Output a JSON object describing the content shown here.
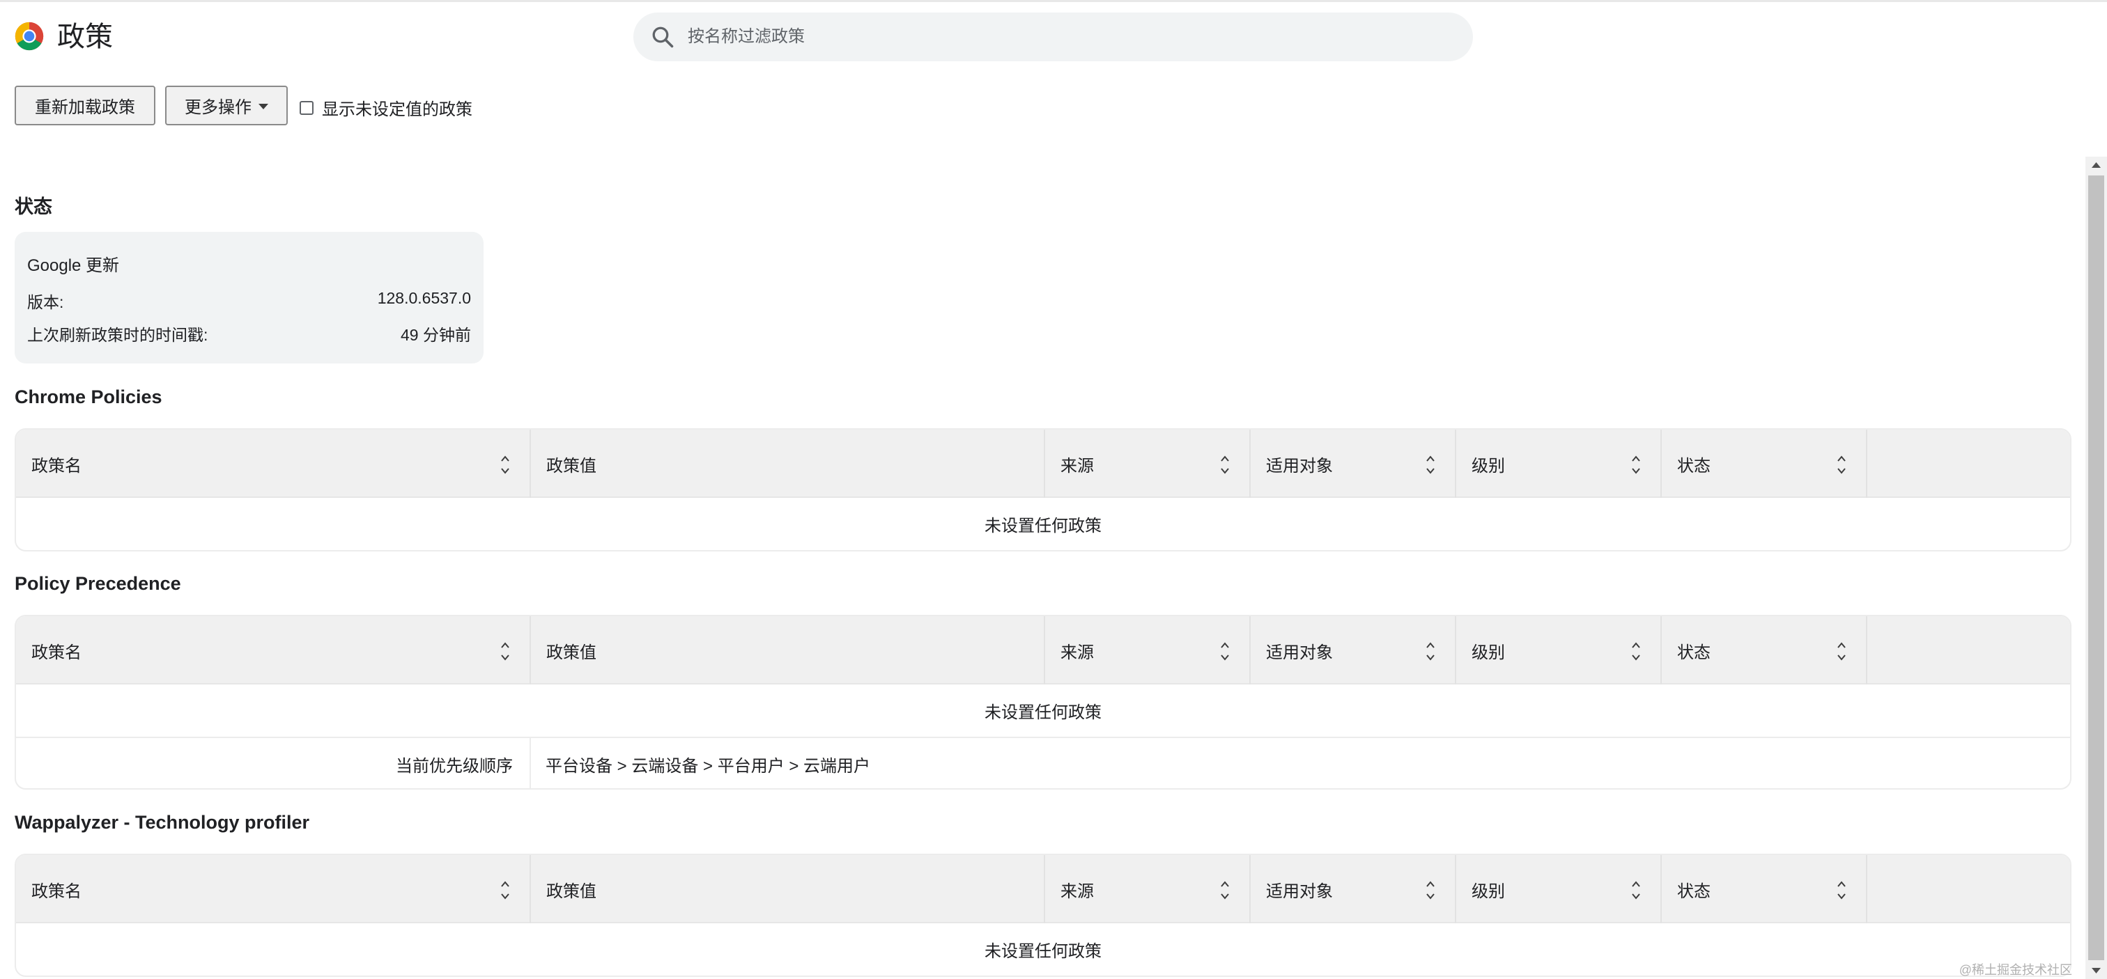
{
  "header": {
    "title": "政策",
    "search_placeholder": "按名称过滤政策"
  },
  "toolbar": {
    "reload_label": "重新加载政策",
    "more_label": "更多操作",
    "show_unset_label": "显示未设定值的政策"
  },
  "status": {
    "heading": "状态",
    "card_title": "Google 更新",
    "version_label": "版本:",
    "version_value": "128.0.6537.0",
    "refresh_label": "上次刷新政策时的时间戳:",
    "refresh_value": "49 分钟前"
  },
  "columns": {
    "policy_name": "政策名",
    "policy_value": "政策值",
    "source": "来源",
    "applies_to": "适用对象",
    "level": "级别",
    "status": "状态"
  },
  "sections": {
    "chrome": {
      "title": "Chrome Policies",
      "empty_text": "未设置任何政策"
    },
    "precedence": {
      "title": "Policy Precedence",
      "empty_text": "未设置任何政策",
      "order_label": "当前优先级顺序",
      "order_value": "平台设备 > 云端设备 > 平台用户 > 云端用户"
    },
    "wappalyzer": {
      "title": "Wappalyzer - Technology profiler",
      "empty_text": "未设置任何政策"
    }
  },
  "watermark": "@稀土掘金技术社区",
  "icons": {
    "logo": "chrome-logo-icon",
    "search": "search-icon",
    "sort": "sort-updown-icon",
    "dropdown": "caret-down-icon"
  },
  "colors": {
    "search_bg": "#f1f3f4",
    "card_bg": "#f1f3f4",
    "table_header_bg": "#f0f0f0"
  }
}
